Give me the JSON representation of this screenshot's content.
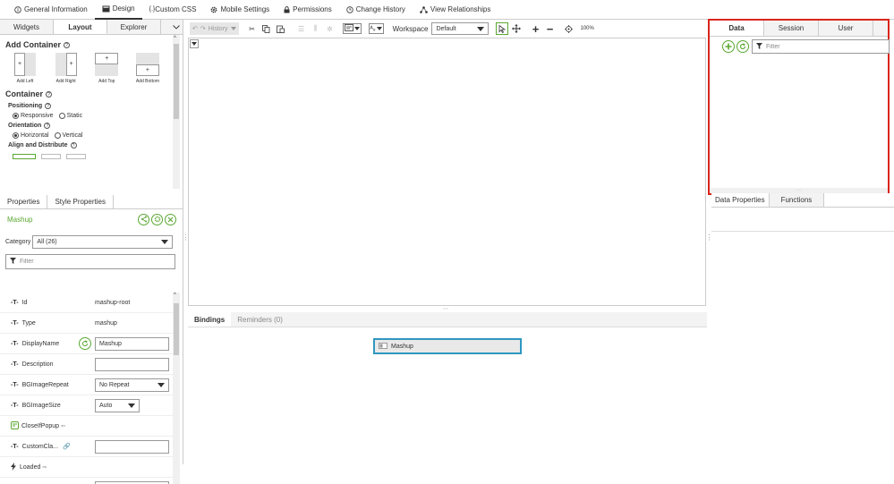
{
  "topnav": {
    "tabs": [
      {
        "label": "General Information",
        "icon": "info-icon"
      },
      {
        "label": "Design",
        "icon": "design-icon",
        "active": true
      },
      {
        "label": "Custom CSS",
        "icon": "css-icon"
      },
      {
        "label": "Mobile Settings",
        "icon": "gear-icon"
      },
      {
        "label": "Permissions",
        "icon": "lock-icon"
      },
      {
        "label": "Change History",
        "icon": "clock-icon"
      },
      {
        "label": "View Relationships",
        "icon": "relationships-icon"
      }
    ]
  },
  "left_panel": {
    "tabs": {
      "widgets": "Widgets",
      "layout": "Layout",
      "explorer": "Explorer"
    },
    "add_container": {
      "title": "Add Container",
      "items": [
        "Add Left",
        "Add Right",
        "Add Top",
        "Add Bottom"
      ]
    },
    "container": {
      "title": "Container",
      "positioning": {
        "label": "Positioning",
        "options": [
          "Responsive",
          "Static"
        ],
        "selected": "Responsive"
      },
      "orientation": {
        "label": "Orientation",
        "options": [
          "Horizontal",
          "Vertical"
        ],
        "selected": "Horizontal"
      },
      "align": {
        "label": "Align and Distribute"
      }
    },
    "properties_tabs": {
      "properties": "Properties",
      "style": "Style Properties"
    },
    "mashup_title": "Mashup",
    "category": {
      "label": "Category",
      "value": "All (26)"
    },
    "filter_placeholder": "Filter",
    "properties": [
      {
        "name": "Id",
        "value": "mashup-root"
      },
      {
        "name": "Type",
        "value": "mashup"
      },
      {
        "name": "DisplayName",
        "value": "Mashup"
      },
      {
        "name": "Description",
        "value": ""
      },
      {
        "name": "BGImageRepeat",
        "value": "No Repeat"
      },
      {
        "name": "BGImageSize",
        "value": "Auto"
      },
      {
        "name": "CloseIfPopup",
        "value": ""
      },
      {
        "name": "CustomCla...",
        "value": ""
      },
      {
        "name": "Loaded",
        "value": ""
      }
    ]
  },
  "toolbar": {
    "history_label": "History",
    "workspace_label": "Workspace",
    "workspace_value": "Default",
    "zoom": "100%"
  },
  "bindings": {
    "tabs": {
      "bindings": "Bindings",
      "reminders": "Reminders (0)"
    },
    "node_label": "Mashup"
  },
  "right_panel": {
    "tabs": {
      "data": "Data",
      "session": "Session",
      "user": "User"
    },
    "filter_placeholder": "Filter",
    "bottom_tabs": {
      "data_properties": "Data Properties",
      "functions": "Functions"
    }
  },
  "colors": {
    "accent_green": "#5aa832",
    "highlight_red": "#d9261c",
    "selection_blue": "#2f97c1"
  }
}
